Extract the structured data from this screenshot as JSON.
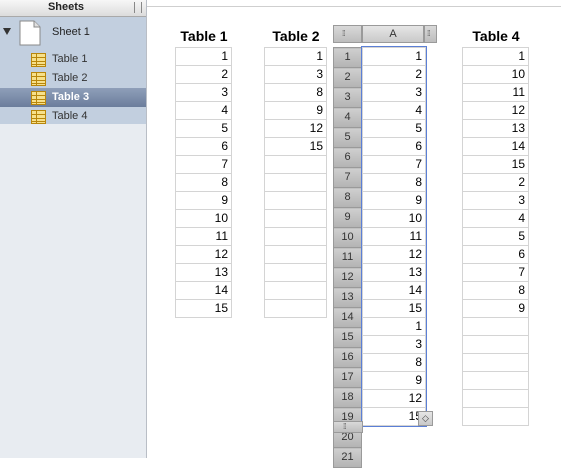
{
  "sidebar": {
    "header": "Sheets",
    "sheet": {
      "label": "Sheet 1"
    },
    "tables": [
      {
        "label": "Table 1",
        "selected": false
      },
      {
        "label": "Table 2",
        "selected": false
      },
      {
        "label": "Table 3",
        "selected": true
      },
      {
        "label": "Table 4",
        "selected": false
      }
    ]
  },
  "canvas": {
    "table1": {
      "title": "Table 1",
      "values": [
        "1",
        "2",
        "3",
        "4",
        "5",
        "6",
        "7",
        "8",
        "9",
        "10",
        "11",
        "12",
        "13",
        "14",
        "15"
      ]
    },
    "table2": {
      "title": "Table 2",
      "values": [
        "1",
        "3",
        "8",
        "9",
        "12",
        "15",
        "",
        "",
        "",
        "",
        "",
        "",
        "",
        "",
        ""
      ]
    },
    "table3": {
      "column_header": "A",
      "row_numbers": [
        "1",
        "2",
        "3",
        "4",
        "5",
        "6",
        "7",
        "8",
        "9",
        "10",
        "11",
        "12",
        "13",
        "14",
        "15",
        "16",
        "17",
        "18",
        "19",
        "20",
        "21"
      ],
      "values": [
        "1",
        "2",
        "3",
        "4",
        "5",
        "6",
        "7",
        "8",
        "9",
        "10",
        "11",
        "12",
        "13",
        "14",
        "15",
        "1",
        "3",
        "8",
        "9",
        "12",
        "15"
      ]
    },
    "table4": {
      "title": "Table 4",
      "values": [
        "1",
        "10",
        "11",
        "12",
        "13",
        "14",
        "15",
        "2",
        "3",
        "4",
        "5",
        "6",
        "7",
        "8",
        "9",
        "",
        "",
        "",
        "",
        "",
        ""
      ]
    }
  },
  "colors": {
    "selection_outline": "#5b7fd6",
    "sidebar_selected": "#7d8eab",
    "sidebar_bg": "#c2cfdf"
  }
}
